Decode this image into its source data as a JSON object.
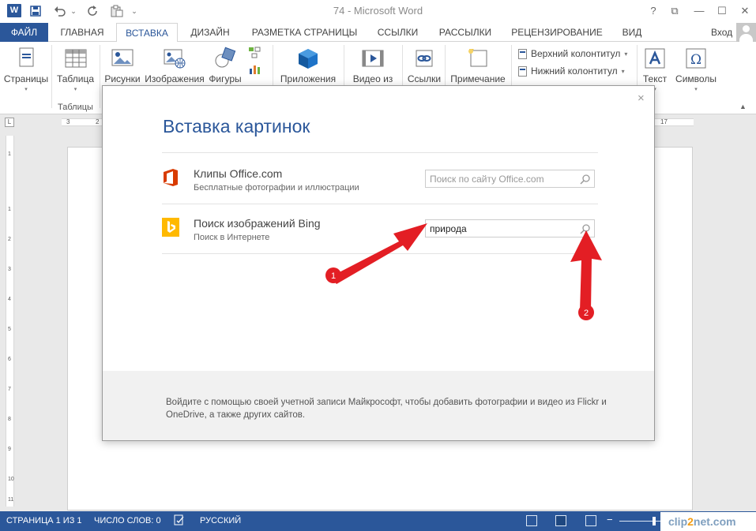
{
  "window": {
    "title": "74 - Microsoft Word",
    "app_badge": "W",
    "help": "?",
    "restore": "⧉",
    "minimize": "—",
    "maximize": "☐",
    "close": "✕"
  },
  "quick_access": {
    "dropdown": "⌄"
  },
  "tabs": {
    "file": "ФАЙЛ",
    "home": "ГЛАВНАЯ",
    "insert": "ВСТАВКА",
    "design": "ДИЗАЙН",
    "layout": "РАЗМЕТКА СТРАНИЦЫ",
    "references": "ССЫЛКИ",
    "mailings": "РАССЫЛКИ",
    "review": "РЕЦЕНЗИРОВАНИЕ",
    "view": "ВИД",
    "active": "insert"
  },
  "account": {
    "login": "Вход"
  },
  "ribbon": {
    "pages": "Страницы",
    "table": "Таблица",
    "pictures": "Рисунки",
    "online_pictures": "Изображения",
    "shapes": "Фигуры",
    "apps": "Приложения",
    "video": "Видео из",
    "links": "Ссылки",
    "comment": "Примечание",
    "header": "Верхний колонтитул",
    "footer": "Нижний колонтитул",
    "text": "Текст",
    "symbols": "Символы",
    "group_tables": "Таблицы",
    "dropdown_arrow": "▾"
  },
  "ruler": {
    "corner": "L",
    "numbers_left": [
      "3",
      "2"
    ],
    "numbers_right": [
      "17"
    ],
    "vertical_numbers": [
      "1",
      "1",
      "2",
      "3",
      "4",
      "5",
      "6",
      "7",
      "8",
      "9",
      "10",
      "11"
    ]
  },
  "dialog": {
    "title": "Вставка картинок",
    "close": "×",
    "sources": [
      {
        "title": "Клипы Office.com",
        "subtitle": "Бесплатные фотографии и иллюстрации",
        "placeholder": "Поиск по сайту Office.com",
        "value": ""
      },
      {
        "title": "Поиск изображений Bing",
        "subtitle": "Поиск в Интернете",
        "placeholder": "",
        "value": "природа"
      }
    ],
    "footer_text": "Войдите с помощью своей учетной записи Майкрософт, чтобы добавить фотографии и видео из Flickr и OneDrive, а также других сайтов."
  },
  "annotations": {
    "arrow1_label": "1",
    "arrow2_label": "2",
    "color": "#e31e24"
  },
  "status": {
    "page": "СТРАНИЦА 1 ИЗ 1",
    "words": "ЧИСЛО СЛОВ: 0",
    "language": "РУССКИЙ"
  },
  "watermark": {
    "part1": "clip",
    "part2": "2",
    "part3": "net.com"
  },
  "colors": {
    "accent": "#2b579a",
    "office_red": "#d83b01",
    "bing_yellow": "#ffb900",
    "arrow_red": "#e31e24"
  }
}
